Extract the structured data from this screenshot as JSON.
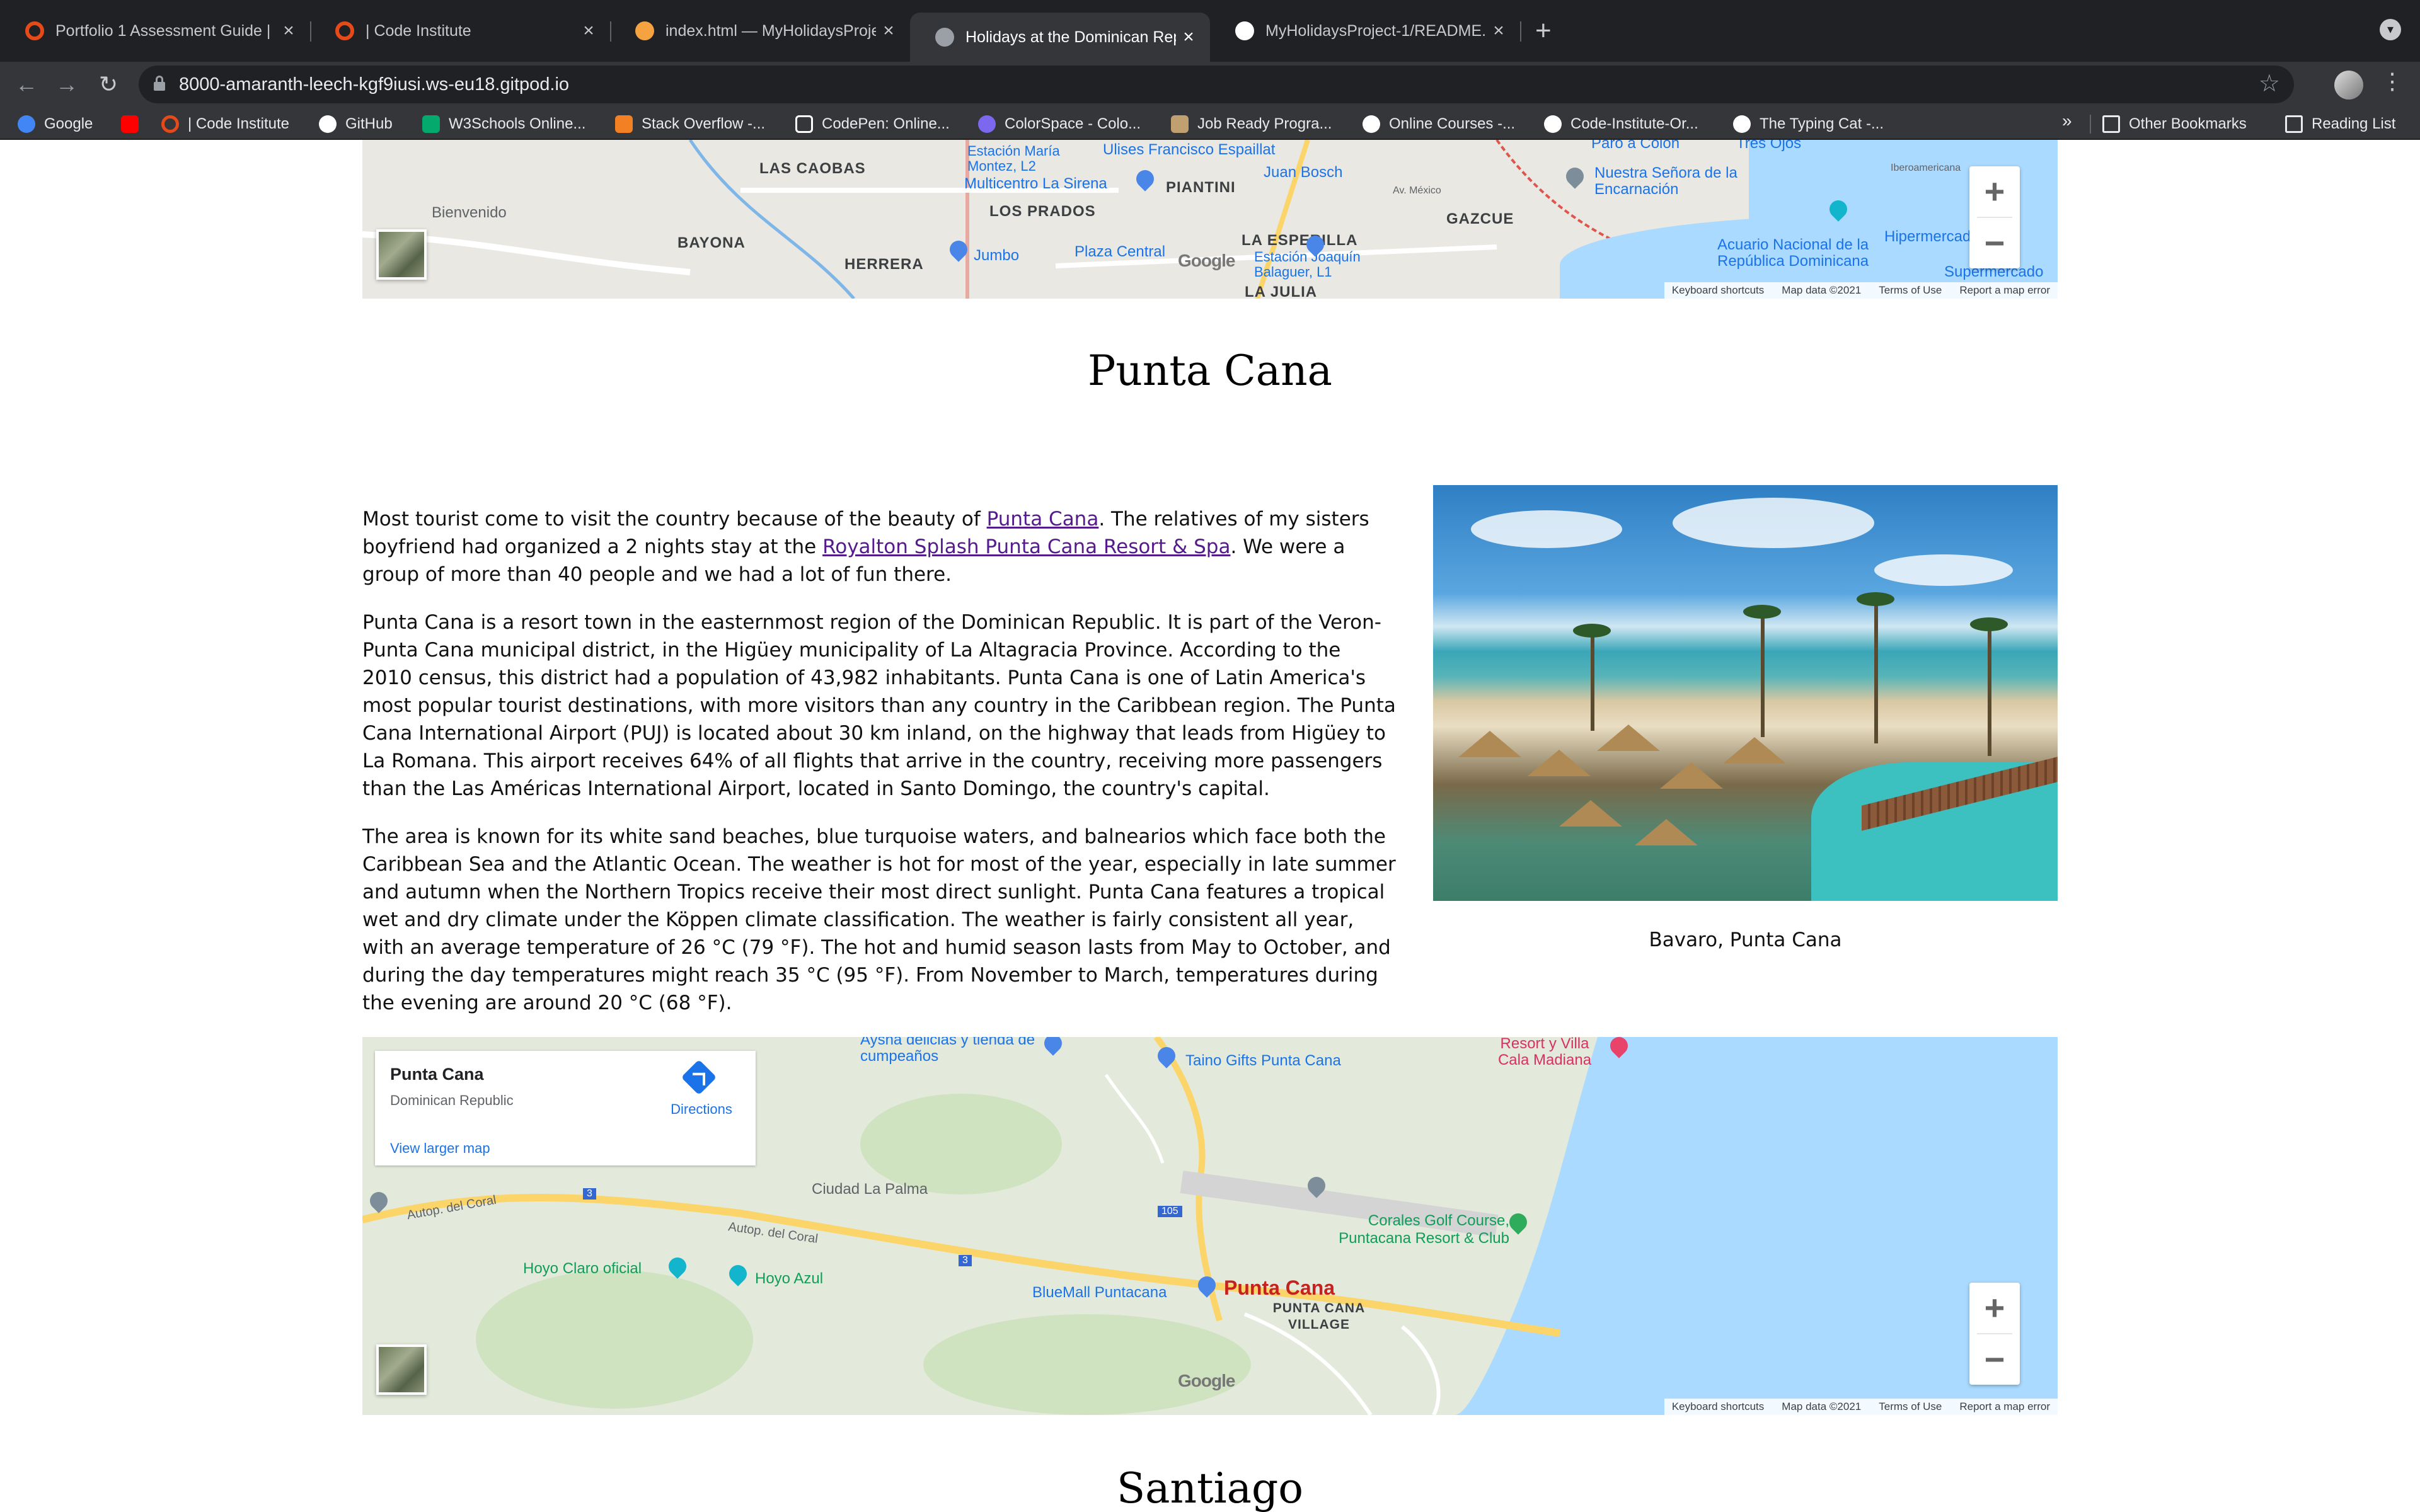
{
  "browser": {
    "tabs": [
      {
        "title": "Portfolio 1 Assessment Guide |",
        "favicon_color": "#e64a19",
        "active": false
      },
      {
        "title": "| Code Institute",
        "favicon_color": "#e64a19",
        "active": false
      },
      {
        "title": "index.html — MyHolidaysProjec",
        "favicon_color": "#f4a340",
        "active": false
      },
      {
        "title": "Holidays at the Dominican Rep",
        "favicon_color": "#9aa0a6",
        "active": true
      },
      {
        "title": "MyHolidaysProject-1/README.",
        "favicon_color": "#ffffff",
        "active": false
      }
    ],
    "new_tab_symbol": "+",
    "close_symbol": "×",
    "url": "8000-amaranth-leech-kgf9iusi.ws-eu18.gitpod.io",
    "bookmarks": [
      {
        "label": "Google",
        "icon": "google-icon",
        "color": "#4285f4"
      },
      {
        "label": "",
        "icon": "youtube-icon",
        "color": "#ff0000"
      },
      {
        "label": "| Code Institute",
        "icon": "code-institute-icon",
        "color": "#e64a19"
      },
      {
        "label": "GitHub",
        "icon": "github-icon",
        "color": "#ffffff"
      },
      {
        "label": "W3Schools Online...",
        "icon": "w3schools-icon",
        "color": "#04aa6d"
      },
      {
        "label": "Stack Overflow -...",
        "icon": "stackoverflow-icon",
        "color": "#f48024"
      },
      {
        "label": "CodePen: Online...",
        "icon": "codepen-icon",
        "color": "#ffffff"
      },
      {
        "label": "ColorSpace - Colo...",
        "icon": "colorspace-icon",
        "color": "#7b68ee"
      },
      {
        "label": "Job Ready Progra...",
        "icon": "jobready-icon",
        "color": "#c0a070"
      },
      {
        "label": "Online Courses -...",
        "icon": "online-courses-icon",
        "color": "#ffffff"
      },
      {
        "label": "Code-Institute-Or...",
        "icon": "github-icon",
        "color": "#ffffff"
      },
      {
        "label": "The Typing Cat -...",
        "icon": "typing-cat-icon",
        "color": "#ffffff"
      }
    ],
    "bookmarks_more": "»",
    "other_bookmarks": "Other Bookmarks",
    "reading_list": "Reading List"
  },
  "top_map": {
    "labels": [
      "Bienvenido",
      "LAS CAOBAS",
      "BAYONA",
      "HERRERA",
      "LOS PRADOS",
      "Jumbo",
      "Plaza Central",
      "PIANTINI",
      "Ulises Francisco Espaillat",
      "Juan Bosch",
      "LA ESPERILLA",
      "Estación Joaquín Balaguer, L1",
      "LA JULIA",
      "GAZCUE",
      "Nuestra Señora de la Encarnación",
      "Acuario Nacional de la República Dominicana",
      "Hipermercado",
      "Supermercado",
      "Multicentro La Sirena",
      "Estación María Montez, L2",
      "Paro a Colón",
      "Tres Ojos",
      "Av. México",
      "Iberoamericana"
    ],
    "google": "Google",
    "footer": [
      "Keyboard shortcuts",
      "Map data ©2021",
      "Terms of Use",
      "Report a map error"
    ],
    "zoom_in": "+",
    "zoom_out": "−"
  },
  "section": {
    "title": "Punta Cana",
    "p1": {
      "before": "Most tourist come to visit the country because of the beauty of ",
      "link1": "Punta Cana",
      "middle": ". The relatives of my sisters boyfriend had organized a 2 nights stay at the ",
      "link2": "Royalton Splash Punta Cana Resort & Spa",
      "after": ". We were a group of more than 40 people and we had a lot of fun there."
    },
    "p2": "Punta Cana is a resort town in the easternmost region of the Dominican Republic. It is part of the Veron-Punta Cana municipal district, in the Higüey municipality of La Altagracia Province. According to the 2010 census, this district had a population of 43,982 inhabitants. Punta Cana is one of Latin America's most popular tourist destinations, with more visitors than any country in the Caribbean region. The Punta Cana International Airport (PUJ) is located about 30 km inland, on the highway that leads from Higüey to La Romana. This airport receives 64% of all flights that arrive in the country, receiving more passengers than the Las Américas International Airport, located in Santo Domingo, the country's capital.",
    "p3": "The area is known for its white sand beaches, blue turquoise waters, and balnearios which face both the Caribbean Sea and the Atlantic Ocean. The weather is hot for most of the year, especially in late summer and autumn when the Northern Tropics receive their most direct sunlight. Punta Cana features a tropical wet and dry climate under the Köppen climate classification. The weather is fairly consistent all year, with an average temperature of 26 °C (79 °F). The hot and humid season lasts from May to October, and during the day temperatures might reach 35 °C (95 °F). From November to March, temperatures during the evening are around 20 °C (68 °F).",
    "image_caption": "Bavaro, Punta Cana"
  },
  "bottom_map": {
    "place_title": "Punta Cana",
    "place_subtitle": "Dominican Republic",
    "directions": "Directions",
    "view_larger": "View larger map",
    "labels": [
      "Aysna delicias y tienda de cumpeaños",
      "Taino Gifts Punta Cana",
      "Resort y Villa Cala Madiana",
      "Ciudad La Palma",
      "Autop. del Coral",
      "Autop. del Coral",
      "Hoyo Claro oficial",
      "Hoyo Azul",
      "BlueMall Puntacana",
      "Punta Cana",
      "PUNTA CANA VILLAGE",
      "Corales Golf Course, Puntacana Resort & Club",
      "3",
      "3",
      "105"
    ],
    "google": "Google",
    "footer": [
      "Keyboard shortcuts",
      "Map data ©2021",
      "Terms of Use",
      "Report a map error"
    ],
    "zoom_in": "+",
    "zoom_out": "−"
  },
  "next_section": {
    "title": "Santiago"
  }
}
